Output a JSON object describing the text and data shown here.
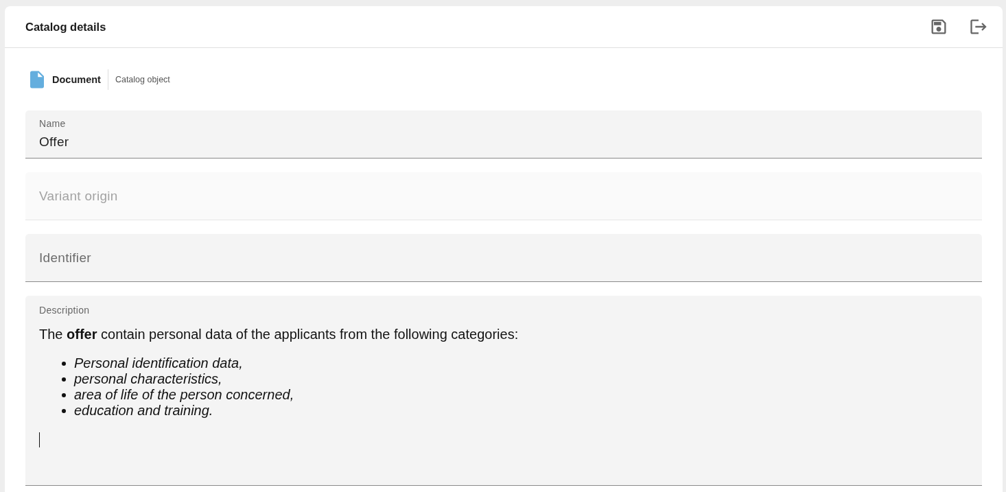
{
  "header": {
    "title": "Catalog details",
    "actions": [
      {
        "kind": "save"
      },
      {
        "kind": "exit"
      }
    ]
  },
  "breadcrumb": {
    "type": "Document",
    "subtitle": "Catalog object"
  },
  "fields": [
    {
      "kind": "text",
      "label": "Name",
      "value": "Offer",
      "disabled": false
    },
    {
      "kind": "text",
      "label": "Variant origin",
      "disabled": true
    },
    {
      "kind": "text",
      "label": "Identifier",
      "disabled": false
    },
    {
      "kind": "rich_text",
      "label": "Description",
      "paragraph": "The **offer** contain personal data of the applicants from the following categories:",
      "list_items": [
        "Personal identification data,",
        "personal characteristics,",
        "area of life of the person concerned,",
        "education and training."
      ],
      "disabled": false
    }
  ]
}
